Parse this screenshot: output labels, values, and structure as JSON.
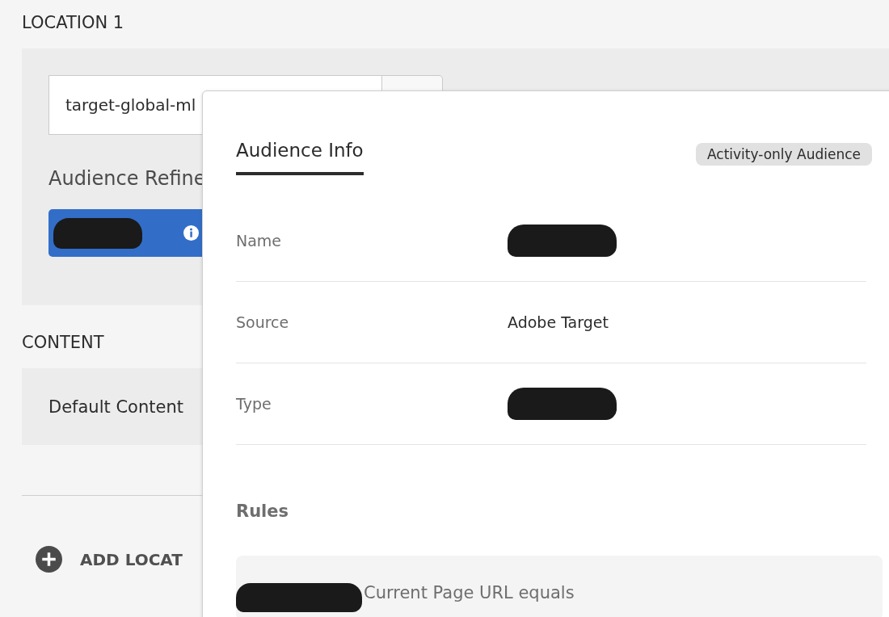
{
  "location": {
    "title": "LOCATION 1",
    "field_value": "target-global-ml",
    "refinement_label": "Audience Refine",
    "chip": {
      "redacted": true
    }
  },
  "content": {
    "title": "CONTENT",
    "item": "Default Content"
  },
  "add_location": {
    "label": "ADD LOCAT"
  },
  "popover": {
    "tab": {
      "label": "Audience Info",
      "selected": true
    },
    "badge": "Activity-only Audience",
    "rows": [
      {
        "label": "Name",
        "redacted": true
      },
      {
        "label": "Source",
        "value": "Adobe Target",
        "redacted": false
      },
      {
        "label": "Type",
        "redacted": true
      }
    ],
    "rules_title": "Rules",
    "rules": [
      {
        "text": "Current Page URL equals",
        "redacted": true
      }
    ]
  }
}
